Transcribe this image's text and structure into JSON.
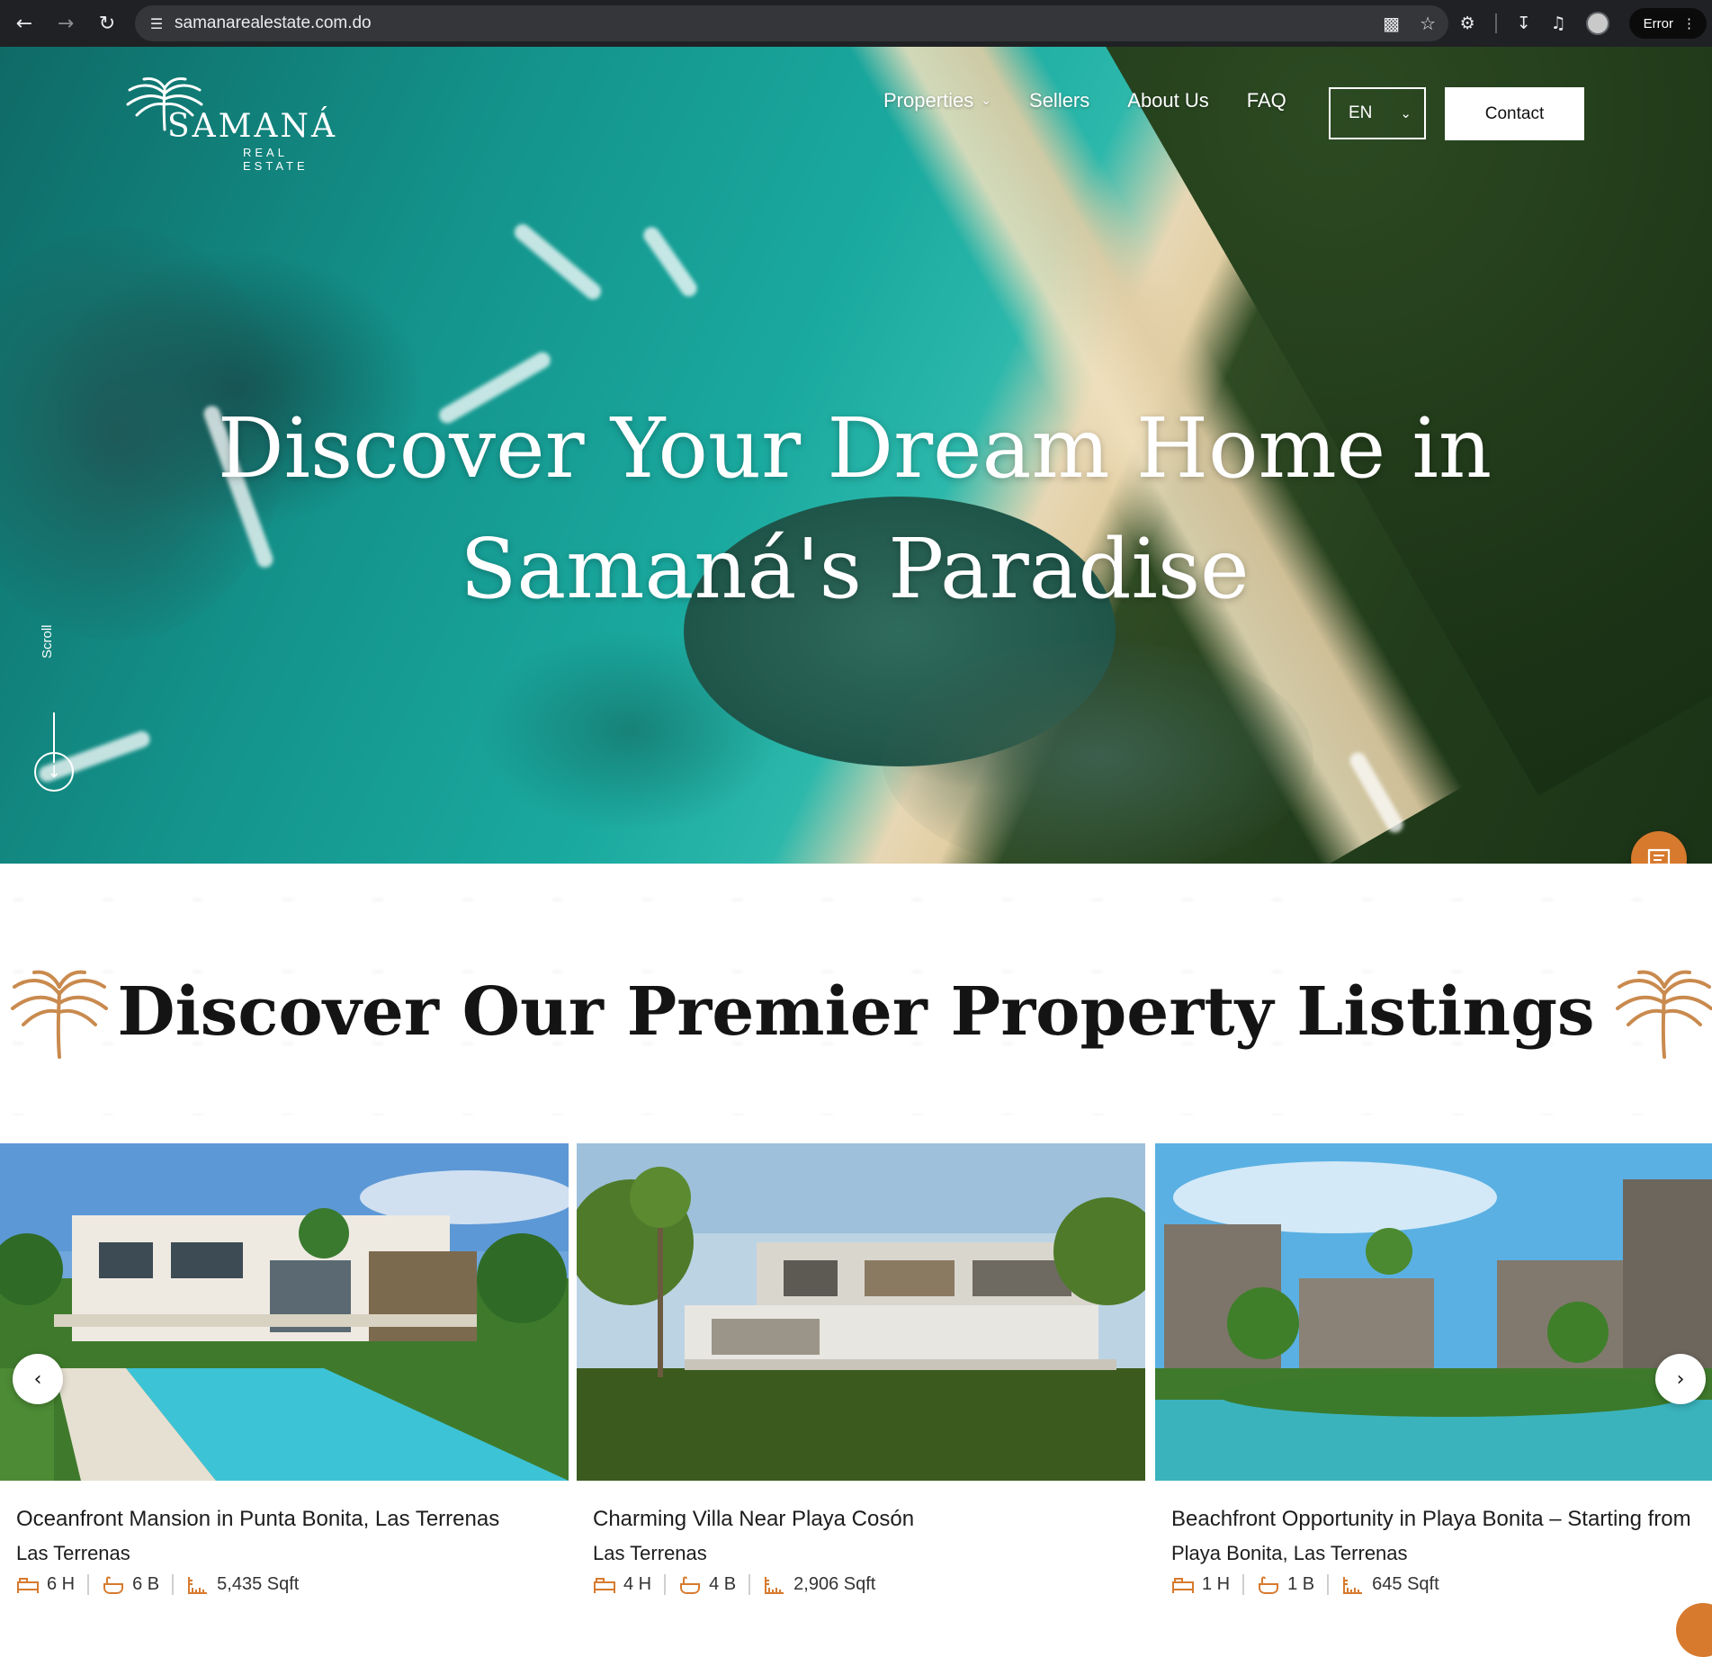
{
  "browser": {
    "url": "samanarealestate.com.do",
    "error_label": "Error"
  },
  "header": {
    "logo_word": "SAMANÁ",
    "logo_sub": "REAL ESTATE",
    "nav": {
      "properties": "Properties",
      "sellers": "Sellers",
      "about": "About Us",
      "faq": "FAQ"
    },
    "language": "EN",
    "contact_label": "Contact"
  },
  "hero": {
    "title_line1": "Discover Your Dream Home in",
    "title_line2": "Samaná's Paradise",
    "scroll_label": "Scroll"
  },
  "listings": {
    "section_title": "Discover Our Premier Property Listings",
    "cards": [
      {
        "title": "Oceanfront Mansion in Punta Bonita, Las Terrenas",
        "location": "Las Terrenas",
        "rooms": "6 H",
        "baths": "6 B",
        "area": "5,435 Sqft"
      },
      {
        "title": "Charming Villa Near Playa Cosón",
        "location": "Las Terrenas",
        "rooms": "4 H",
        "baths": "4 B",
        "area": "2,906 Sqft"
      },
      {
        "title": "Beachfront Opportunity in Playa Bonita – Starting from",
        "location": "Playa Bonita, Las Terrenas",
        "rooms": "1 H",
        "baths": "1 B",
        "area": "645 Sqft"
      }
    ]
  },
  "colors": {
    "accent": "#d77a2e",
    "chrome_bg": "#202124"
  },
  "icons": {
    "back": "arrow-left-icon",
    "forward": "arrow-right-icon",
    "reload": "reload-icon",
    "site_info": "tune-icon",
    "install": "install-icon",
    "bookmark": "star-icon",
    "extensions": "puzzle-icon",
    "downloads": "download-icon",
    "media": "media-icon",
    "chat": "chat-icon",
    "bed": "bed-icon",
    "bath": "bath-icon",
    "area": "area-icon"
  }
}
